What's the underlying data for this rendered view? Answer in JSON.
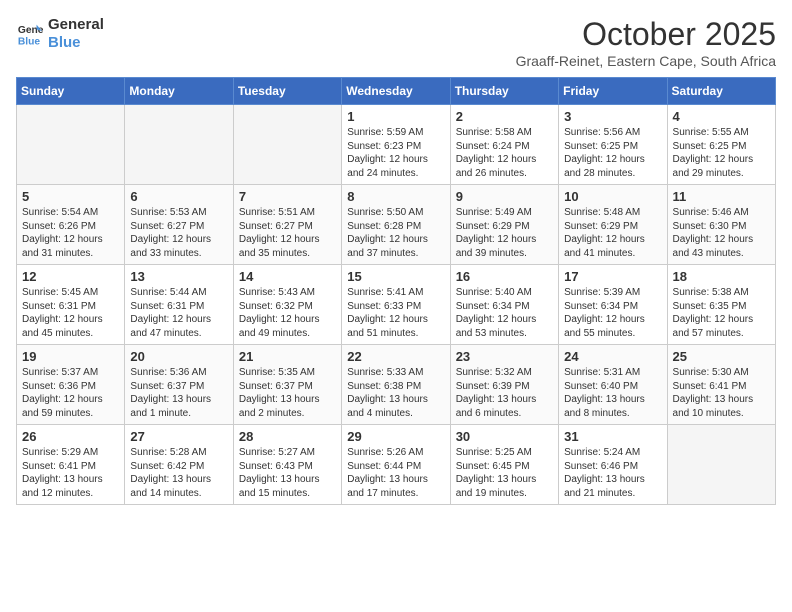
{
  "header": {
    "logo_line1": "General",
    "logo_line2": "Blue",
    "month": "October 2025",
    "location": "Graaff-Reinet, Eastern Cape, South Africa"
  },
  "days_of_week": [
    "Sunday",
    "Monday",
    "Tuesday",
    "Wednesday",
    "Thursday",
    "Friday",
    "Saturday"
  ],
  "weeks": [
    [
      {
        "day": "",
        "empty": true
      },
      {
        "day": "",
        "empty": true
      },
      {
        "day": "",
        "empty": true
      },
      {
        "day": "1",
        "info": "Sunrise: 5:59 AM\nSunset: 6:23 PM\nDaylight: 12 hours\nand 24 minutes."
      },
      {
        "day": "2",
        "info": "Sunrise: 5:58 AM\nSunset: 6:24 PM\nDaylight: 12 hours\nand 26 minutes."
      },
      {
        "day": "3",
        "info": "Sunrise: 5:56 AM\nSunset: 6:25 PM\nDaylight: 12 hours\nand 28 minutes."
      },
      {
        "day": "4",
        "info": "Sunrise: 5:55 AM\nSunset: 6:25 PM\nDaylight: 12 hours\nand 29 minutes."
      }
    ],
    [
      {
        "day": "5",
        "info": "Sunrise: 5:54 AM\nSunset: 6:26 PM\nDaylight: 12 hours\nand 31 minutes."
      },
      {
        "day": "6",
        "info": "Sunrise: 5:53 AM\nSunset: 6:27 PM\nDaylight: 12 hours\nand 33 minutes."
      },
      {
        "day": "7",
        "info": "Sunrise: 5:51 AM\nSunset: 6:27 PM\nDaylight: 12 hours\nand 35 minutes."
      },
      {
        "day": "8",
        "info": "Sunrise: 5:50 AM\nSunset: 6:28 PM\nDaylight: 12 hours\nand 37 minutes."
      },
      {
        "day": "9",
        "info": "Sunrise: 5:49 AM\nSunset: 6:29 PM\nDaylight: 12 hours\nand 39 minutes."
      },
      {
        "day": "10",
        "info": "Sunrise: 5:48 AM\nSunset: 6:29 PM\nDaylight: 12 hours\nand 41 minutes."
      },
      {
        "day": "11",
        "info": "Sunrise: 5:46 AM\nSunset: 6:30 PM\nDaylight: 12 hours\nand 43 minutes."
      }
    ],
    [
      {
        "day": "12",
        "info": "Sunrise: 5:45 AM\nSunset: 6:31 PM\nDaylight: 12 hours\nand 45 minutes."
      },
      {
        "day": "13",
        "info": "Sunrise: 5:44 AM\nSunset: 6:31 PM\nDaylight: 12 hours\nand 47 minutes."
      },
      {
        "day": "14",
        "info": "Sunrise: 5:43 AM\nSunset: 6:32 PM\nDaylight: 12 hours\nand 49 minutes."
      },
      {
        "day": "15",
        "info": "Sunrise: 5:41 AM\nSunset: 6:33 PM\nDaylight: 12 hours\nand 51 minutes."
      },
      {
        "day": "16",
        "info": "Sunrise: 5:40 AM\nSunset: 6:34 PM\nDaylight: 12 hours\nand 53 minutes."
      },
      {
        "day": "17",
        "info": "Sunrise: 5:39 AM\nSunset: 6:34 PM\nDaylight: 12 hours\nand 55 minutes."
      },
      {
        "day": "18",
        "info": "Sunrise: 5:38 AM\nSunset: 6:35 PM\nDaylight: 12 hours\nand 57 minutes."
      }
    ],
    [
      {
        "day": "19",
        "info": "Sunrise: 5:37 AM\nSunset: 6:36 PM\nDaylight: 12 hours\nand 59 minutes."
      },
      {
        "day": "20",
        "info": "Sunrise: 5:36 AM\nSunset: 6:37 PM\nDaylight: 13 hours\nand 1 minute."
      },
      {
        "day": "21",
        "info": "Sunrise: 5:35 AM\nSunset: 6:37 PM\nDaylight: 13 hours\nand 2 minutes."
      },
      {
        "day": "22",
        "info": "Sunrise: 5:33 AM\nSunset: 6:38 PM\nDaylight: 13 hours\nand 4 minutes."
      },
      {
        "day": "23",
        "info": "Sunrise: 5:32 AM\nSunset: 6:39 PM\nDaylight: 13 hours\nand 6 minutes."
      },
      {
        "day": "24",
        "info": "Sunrise: 5:31 AM\nSunset: 6:40 PM\nDaylight: 13 hours\nand 8 minutes."
      },
      {
        "day": "25",
        "info": "Sunrise: 5:30 AM\nSunset: 6:41 PM\nDaylight: 13 hours\nand 10 minutes."
      }
    ],
    [
      {
        "day": "26",
        "info": "Sunrise: 5:29 AM\nSunset: 6:41 PM\nDaylight: 13 hours\nand 12 minutes."
      },
      {
        "day": "27",
        "info": "Sunrise: 5:28 AM\nSunset: 6:42 PM\nDaylight: 13 hours\nand 14 minutes."
      },
      {
        "day": "28",
        "info": "Sunrise: 5:27 AM\nSunset: 6:43 PM\nDaylight: 13 hours\nand 15 minutes."
      },
      {
        "day": "29",
        "info": "Sunrise: 5:26 AM\nSunset: 6:44 PM\nDaylight: 13 hours\nand 17 minutes."
      },
      {
        "day": "30",
        "info": "Sunrise: 5:25 AM\nSunset: 6:45 PM\nDaylight: 13 hours\nand 19 minutes."
      },
      {
        "day": "31",
        "info": "Sunrise: 5:24 AM\nSunset: 6:46 PM\nDaylight: 13 hours\nand 21 minutes."
      },
      {
        "day": "",
        "empty": true
      }
    ]
  ]
}
